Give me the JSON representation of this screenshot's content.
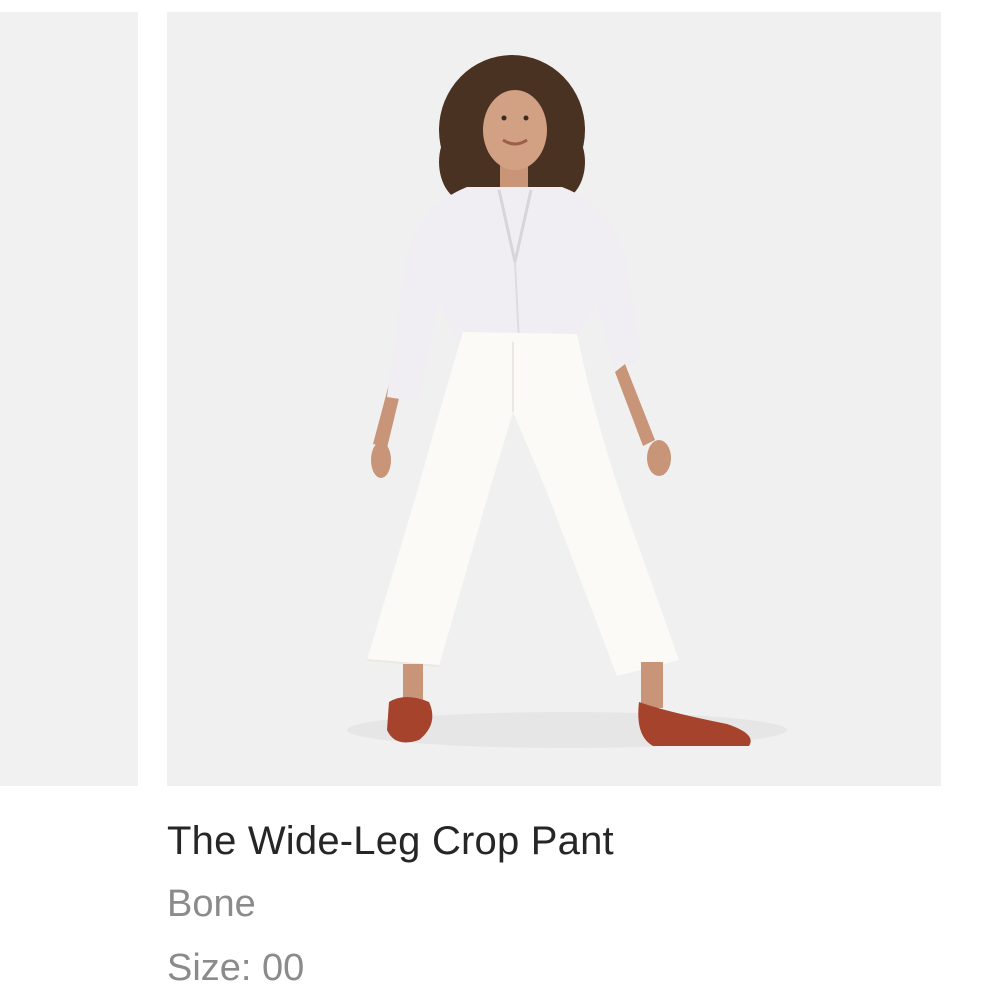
{
  "product": {
    "name": "The Wide-Leg Crop Pant",
    "color": "Bone",
    "size": "Size: 00"
  },
  "images": {
    "main": "product-photo-model-wearing-wide-leg-crop-pant",
    "previous": "previous-product-photo-partial"
  },
  "colors": {
    "image_background": "#f0f0f0",
    "title_text": "#262626",
    "meta_text": "#8b8b8b"
  }
}
